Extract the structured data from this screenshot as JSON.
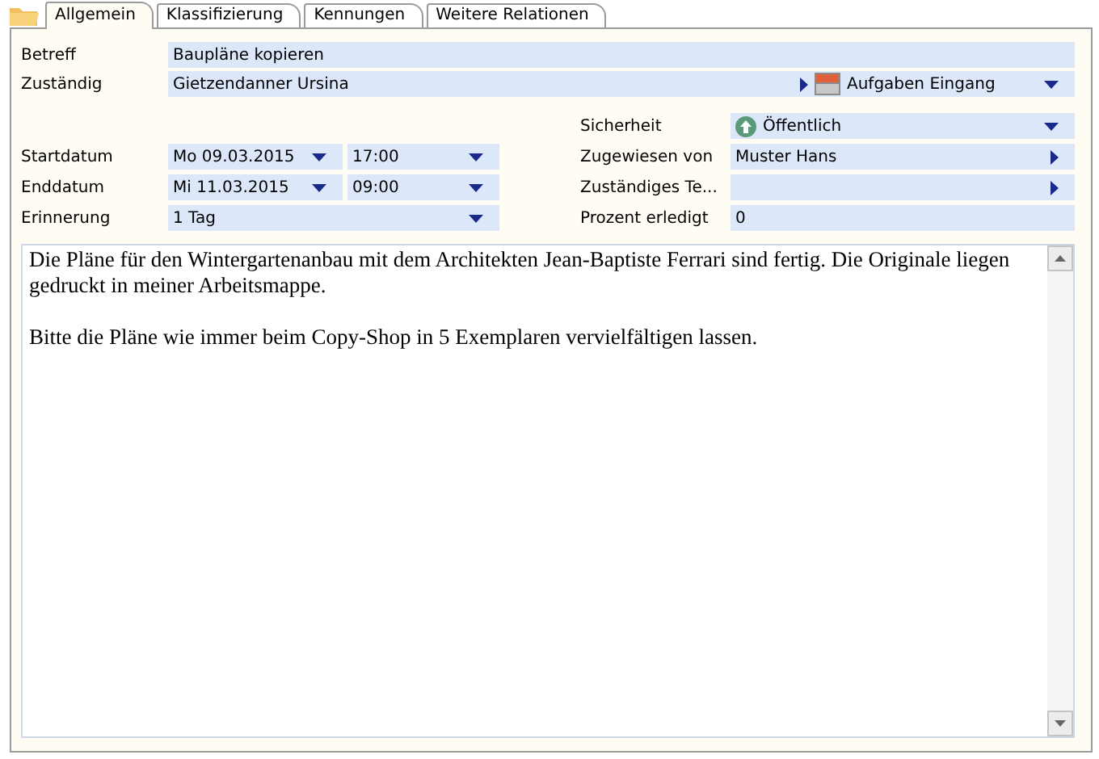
{
  "tabs": [
    {
      "label": "Allgemein",
      "selected": true
    },
    {
      "label": "Klassifizierung",
      "selected": false
    },
    {
      "label": "Kennungen",
      "selected": false
    },
    {
      "label": "Weitere Relationen",
      "selected": false
    }
  ],
  "betreff": {
    "label": "Betreff",
    "value": "Baupläne kopieren"
  },
  "zustaendig": {
    "label": "Zuständig",
    "value": "Gietzendanner Ursina",
    "folder": "Aufgaben Eingang"
  },
  "left_fields": [
    {
      "kind": "datetime",
      "label": "Startdatum",
      "date": "Mo 09.03.2015",
      "time": "17:00"
    },
    {
      "kind": "datetime",
      "label": "Enddatum",
      "date": "Mi 11.03.2015",
      "time": "09:00"
    },
    {
      "kind": "select",
      "label": "Erinnerung",
      "value": "1 Tag"
    }
  ],
  "right_fields": [
    {
      "kind": "status-select",
      "label": "Sicherheit",
      "value": "Öffentlich"
    },
    {
      "kind": "link",
      "label": "Zugewiesen von",
      "value": "Muster Hans"
    },
    {
      "kind": "link",
      "label": "Zuständiges Te..."
    },
    {
      "kind": "text",
      "label": "Prozent erledigt",
      "value": "0"
    }
  ],
  "notes": {
    "paragraphs": [
      "Die Pläne für den Wintergartenanbau mit dem Architekten Jean-Baptiste Ferrari sind fertig. Die Originale liegen gedruckt in meiner Arbeitsmappe.",
      "Bitte die Pläne wie immer beim Copy-Shop in 5 Exemplaren vervielfältigen lassen."
    ]
  }
}
